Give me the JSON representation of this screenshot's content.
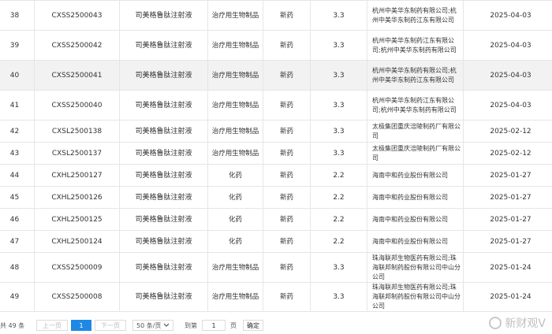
{
  "rows": [
    {
      "no": "38",
      "code": "CXSS2500043",
      "name": "司美格鲁肽注射液",
      "type": "治疗用生物制品",
      "category": "新药",
      "grade": "3.3",
      "mfr": "杭州中美华东制药有限公司;杭州中美华东制药江东有限公司",
      "date": "2025-04-03",
      "highlight": false
    },
    {
      "no": "39",
      "code": "CXSS2500042",
      "name": "司美格鲁肽注射液",
      "type": "治疗用生物制品",
      "category": "新药",
      "grade": "3.3",
      "mfr": "杭州中美华东制药江东有限公司;杭州中美华东制药有限公司",
      "date": "2025-04-03",
      "highlight": false
    },
    {
      "no": "40",
      "code": "CXSS2500041",
      "name": "司美格鲁肽注射液",
      "type": "治疗用生物制品",
      "category": "新药",
      "grade": "3.3",
      "mfr": "杭州中美华东制药有限公司;杭州中美华东制药江东有限公司",
      "date": "2025-04-03",
      "highlight": true
    },
    {
      "no": "41",
      "code": "CXSS2500040",
      "name": "司美格鲁肽注射液",
      "type": "治疗用生物制品",
      "category": "新药",
      "grade": "3.3",
      "mfr": "杭州中美华东制药江东有限公司;杭州中美华东制药有限公司",
      "date": "2025-04-03",
      "highlight": false
    },
    {
      "no": "42",
      "code": "CXSL2500138",
      "name": "司美格鲁肽注射液",
      "type": "治疗用生物制品",
      "category": "新药",
      "grade": "3.3",
      "mfr": "太极集团重庆涪陵制药厂有限公司",
      "date": "2025-02-12",
      "highlight": false
    },
    {
      "no": "43",
      "code": "CXSL2500137",
      "name": "司美格鲁肽注射液",
      "type": "治疗用生物制品",
      "category": "新药",
      "grade": "3.3",
      "mfr": "太极集团重庆涪陵制药厂有限公司",
      "date": "2025-02-12",
      "highlight": false
    },
    {
      "no": "44",
      "code": "CXHL2500127",
      "name": "司美格鲁肽注射液",
      "type": "化药",
      "category": "新药",
      "grade": "2.2",
      "mfr": "海南中和药业股份有限公司",
      "date": "2025-01-27",
      "highlight": false
    },
    {
      "no": "45",
      "code": "CXHL2500126",
      "name": "司美格鲁肽注射液",
      "type": "化药",
      "category": "新药",
      "grade": "2.2",
      "mfr": "海南中和药业股份有限公司",
      "date": "2025-01-27",
      "highlight": false
    },
    {
      "no": "46",
      "code": "CXHL2500125",
      "name": "司美格鲁肽注射液",
      "type": "化药",
      "category": "新药",
      "grade": "2.2",
      "mfr": "海南中和药业股份有限公司",
      "date": "2025-01-27",
      "highlight": false
    },
    {
      "no": "47",
      "code": "CXHL2500124",
      "name": "司美格鲁肽注射液",
      "type": "化药",
      "category": "新药",
      "grade": "2.2",
      "mfr": "海南中和药业股份有限公司",
      "date": "2025-01-27",
      "highlight": false
    },
    {
      "no": "48",
      "code": "CXSS2500009",
      "name": "司美格鲁肽注射液",
      "type": "治疗用生物制品",
      "category": "新药",
      "grade": "3.3",
      "mfr": "珠海联邦生物医药有限公司;珠海联邦制药股份有限公司中山分公司",
      "date": "2025-01-24",
      "highlight": false
    },
    {
      "no": "49",
      "code": "CXSS2500008",
      "name": "司美格鲁肽注射液",
      "type": "治疗用生物制品",
      "category": "新药",
      "grade": "3.3",
      "mfr": "珠海联邦生物医药有限公司;珠海联邦制药股份有限公司中山分公司",
      "date": "2025-01-24",
      "highlight": false
    }
  ],
  "pager": {
    "total": "共 49 条",
    "prev": "上一页",
    "current": "1",
    "next": "下一页",
    "page_size": "50 条/页",
    "goto_label": "到第",
    "goto_value": "1",
    "page_unit": "页",
    "confirm": "确定"
  },
  "watermark": "新财观V",
  "colors": {
    "accent": "#1e88e5",
    "highlight_row": "#f2f2f2"
  }
}
